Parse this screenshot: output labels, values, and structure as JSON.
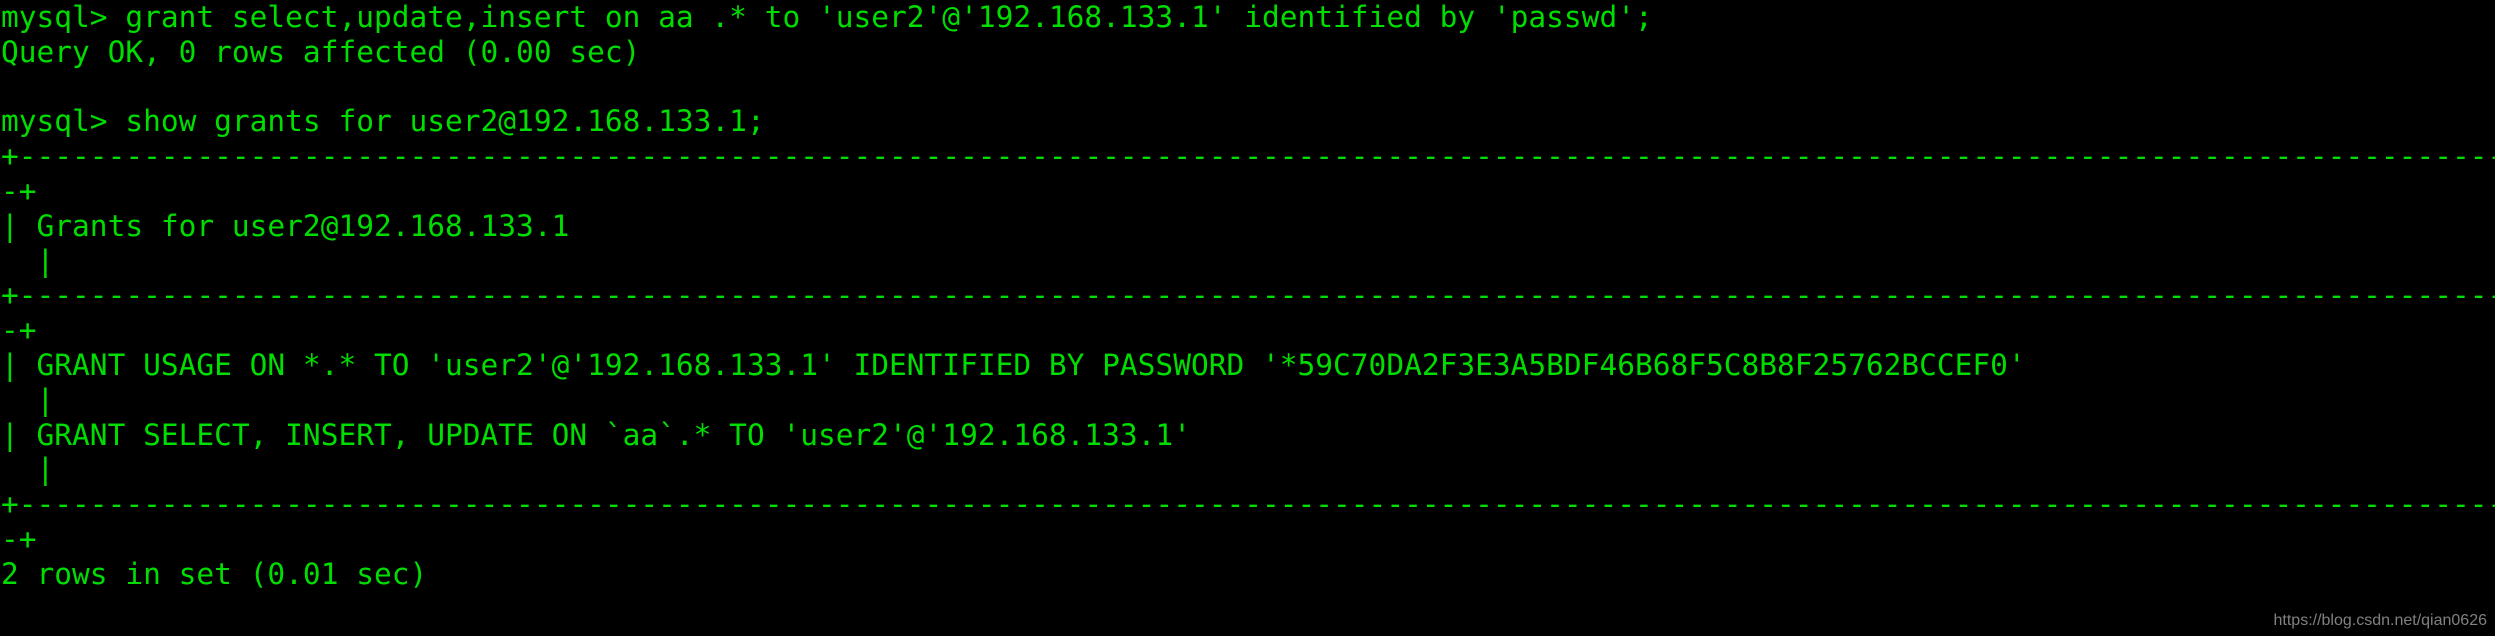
{
  "terminal": {
    "background_color": "#000000",
    "foreground_color": "#00dd00",
    "watermark": "https://blog.csdn.net/qian0626",
    "prompt": "mysql>",
    "lines": [
      "mysql> grant select,update,insert on aa .* to 'user2'@'192.168.133.1' identified by 'passwd';",
      "Query OK, 0 rows affected (0.00 sec)",
      "",
      "mysql> show grants for user2@192.168.133.1;",
      "+---------------------------------------------------------------------------------------------------------------------------------------------------------------------------------------------------------------------------------------------------------------------------------------------",
      "-+",
      "| Grants for user2@192.168.133.1",
      "  |",
      "+---------------------------------------------------------------------------------------------------------------------------------------------------------------------------------------------------------------------------------------------------------------------------------------------",
      "-+",
      "| GRANT USAGE ON *.* TO 'user2'@'192.168.133.1' IDENTIFIED BY PASSWORD '*59C70DA2F3E3A5BDF46B68F5C8B8F25762BCCEF0'",
      "  |",
      "| GRANT SELECT, INSERT, UPDATE ON `aa`.* TO 'user2'@'192.168.133.1'",
      "  |",
      "+---------------------------------------------------------------------------------------------------------------------------------------------------------------------------------------------------------------------------------------------------------------------------------------------",
      "-+",
      "2 rows in set (0.01 sec)"
    ],
    "commands": [
      {
        "prompt": "mysql>",
        "sql": "grant select,update,insert on aa .* to 'user2'@'192.168.133.1' identified by 'passwd';",
        "result": "Query OK, 0 rows affected (0.00 sec)"
      },
      {
        "prompt": "mysql>",
        "sql": "show grants for user2@192.168.133.1;",
        "result": "2 rows in set (0.01 sec)"
      }
    ],
    "grants_table": {
      "column_header": "Grants for user2@192.168.133.1",
      "rows": [
        "GRANT USAGE ON *.* TO 'user2'@'192.168.133.1' IDENTIFIED BY PASSWORD '*59C70DA2F3E3A5BDF46B68F5C8B8F25762BCCEF0'",
        "GRANT SELECT, INSERT, UPDATE ON `aa`.* TO 'user2'@'192.168.133.1'"
      ],
      "row_count": "2 rows in set (0.01 sec)"
    }
  }
}
